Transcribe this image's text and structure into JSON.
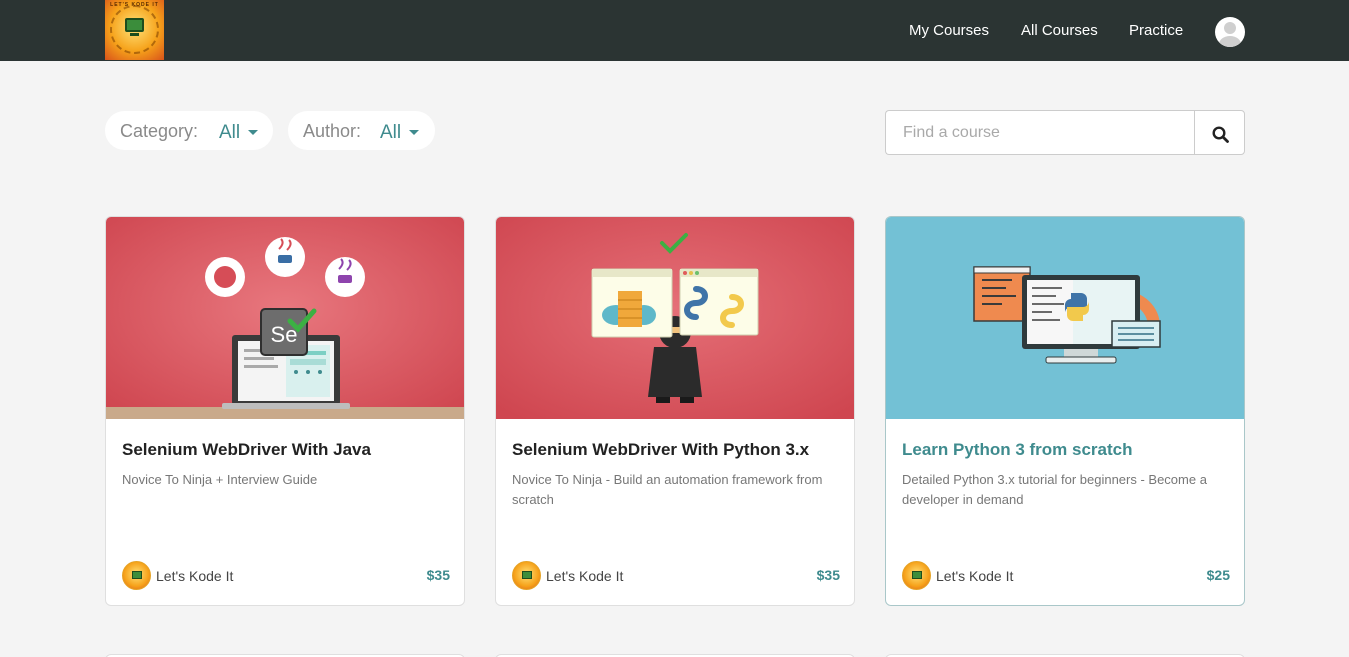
{
  "header": {
    "logo_text": "LET'S KODE IT",
    "nav": [
      "My Courses",
      "All Courses",
      "Practice"
    ]
  },
  "filters": {
    "category_label": "Category:",
    "category_value": "All",
    "author_label": "Author:",
    "author_value": "All"
  },
  "search": {
    "placeholder": "Find a course",
    "icon": "search-icon"
  },
  "courses": [
    {
      "title": "Selenium WebDriver With Java",
      "description": "Novice To Ninja + Interview Guide",
      "author": "Let's Kode It",
      "price": "$35",
      "image_badge_text": "Se"
    },
    {
      "title": "Selenium WebDriver With Python 3.x",
      "description": "Novice To Ninja - Build an automation framework from scratch",
      "author": "Let's Kode It",
      "price": "$35"
    },
    {
      "title": "Learn Python 3 from scratch",
      "description": "Detailed Python 3.x tutorial for beginners - Become a developer in demand",
      "author": "Let's Kode It",
      "price": "$25"
    }
  ],
  "colors": {
    "header_bg": "#2b3433",
    "accent": "#3f8b8e",
    "card_red": "#d64d57",
    "card_blue": "#6ec2d6"
  }
}
